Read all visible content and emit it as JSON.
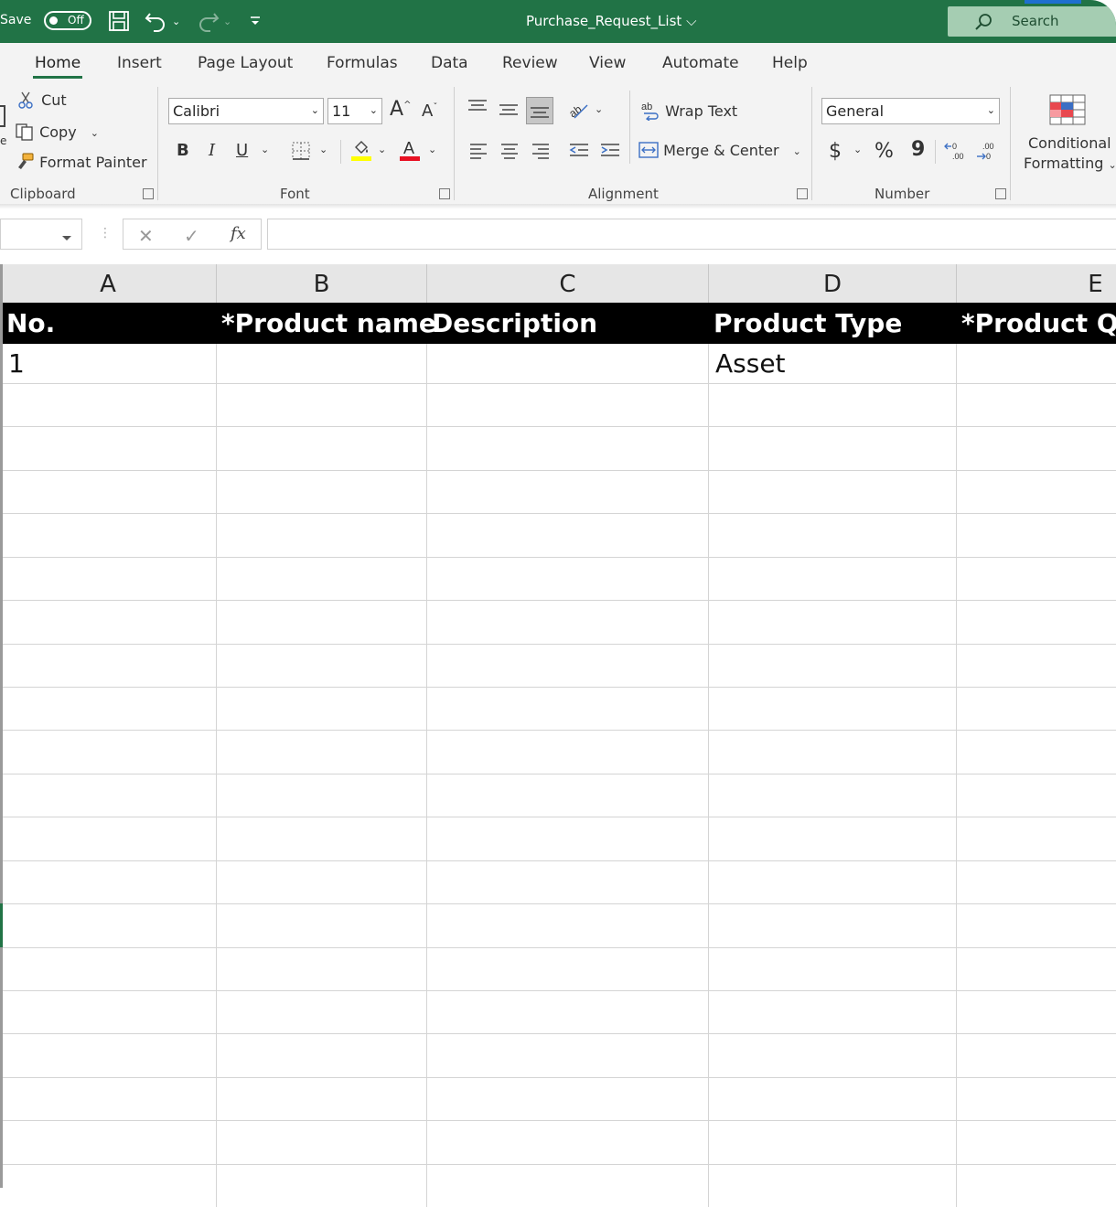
{
  "titlebar": {
    "autosave_label": "Save",
    "autosave_state": "Off",
    "doc_title": "Purchase_Request_List",
    "search_placeholder": "Search"
  },
  "tabs": [
    "Home",
    "Insert",
    "Page Layout",
    "Formulas",
    "Data",
    "Review",
    "View",
    "Automate",
    "Help"
  ],
  "active_tab": "Home",
  "ribbon": {
    "clipboard": {
      "cut": "Cut",
      "copy": "Copy",
      "format_painter": "Format Painter",
      "group_label": "Clipboard"
    },
    "font": {
      "font_name": "Calibri",
      "font_size": "11",
      "group_label": "Font",
      "bold": "B",
      "italic": "I",
      "underline": "U"
    },
    "alignment": {
      "wrap_text": "Wrap Text",
      "merge_center": "Merge & Center",
      "group_label": "Alignment"
    },
    "number": {
      "format": "General",
      "currency": "$",
      "percent": "%",
      "comma": "9",
      "group_label": "Number"
    },
    "styles": {
      "conditional_line1": "Conditional",
      "conditional_line2": "Formatting"
    }
  },
  "formula_bar": {
    "fx": "fx",
    "value": ""
  },
  "columns": [
    "A",
    "B",
    "C",
    "D",
    "E"
  ],
  "header_row": [
    "No.",
    "*Product name",
    "Description",
    "Product Type",
    "*Product Qua"
  ],
  "rows": [
    [
      "1",
      "",
      "",
      "Asset",
      ""
    ]
  ],
  "colors": {
    "accent": "#217346",
    "header_bg": "#000000",
    "font_red": "#e81123",
    "highlight_yellow": "#ffff00"
  }
}
